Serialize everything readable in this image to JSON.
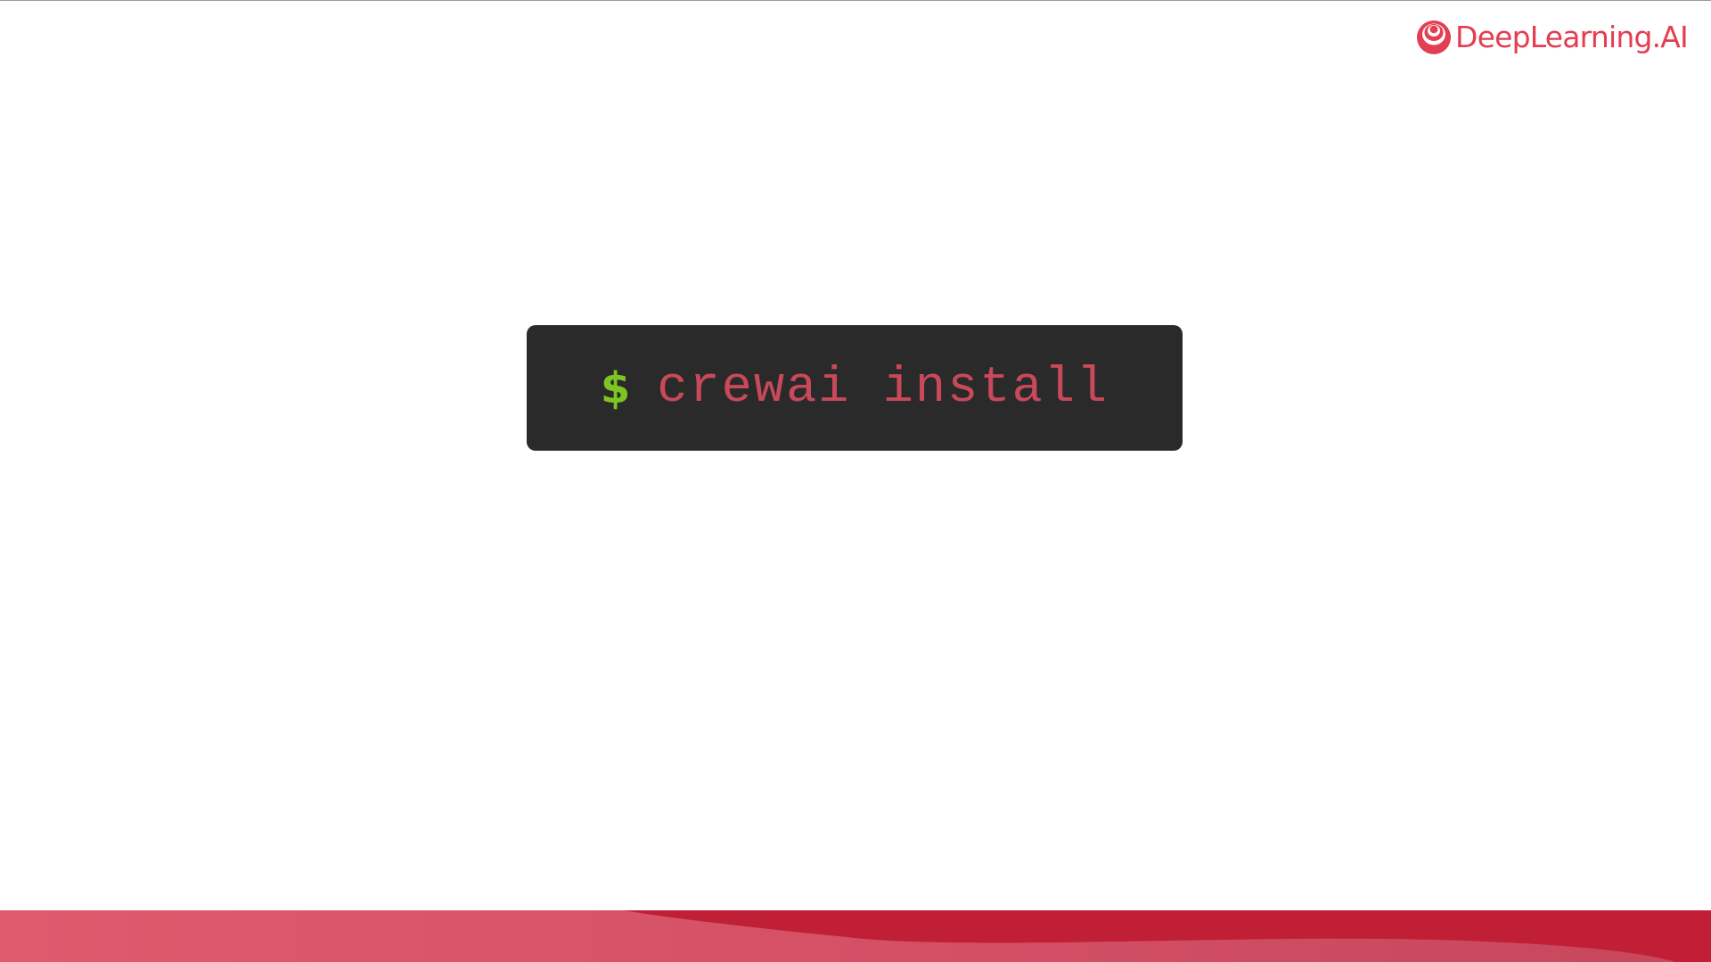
{
  "brand": {
    "logo_text": "DeepLearning.AI",
    "logo_icon": "deeplearning-ai-logo-icon",
    "color": "#e33e51"
  },
  "terminal": {
    "prompt_symbol": "$",
    "command": "crewai install",
    "background_color": "#2a2a2a",
    "prompt_color": "#7dc523",
    "command_color": "#c9495a"
  },
  "footer": {
    "accent_color": "#c01f35",
    "gradient_start": "#e05a6e",
    "gradient_end": "#c8475d"
  }
}
